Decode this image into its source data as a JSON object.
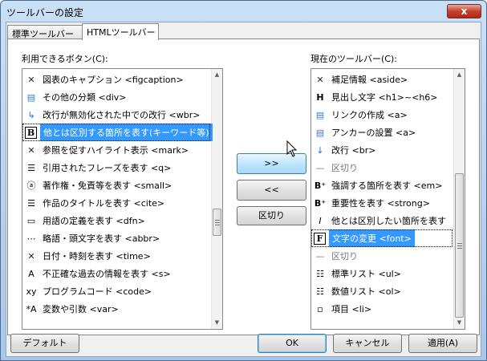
{
  "window": {
    "title": "ツールバーの設定",
    "close_glyph": "x"
  },
  "tabs": [
    {
      "label": "標準ツールバー",
      "active": false
    },
    {
      "label": "HTMLツールバー",
      "active": true
    }
  ],
  "available": {
    "label": "利用できるボタン(C):",
    "items": [
      {
        "icon": "x-icon",
        "glyph": "✕",
        "label": "図表のキャプション <figcaption>"
      },
      {
        "icon": "page-icon",
        "glyph": "▤",
        "label": "その他の分類 <div>"
      },
      {
        "icon": "arrow-icon",
        "glyph": "↳",
        "label": "改行が無効化された中での改行 <wbr>"
      },
      {
        "icon": "bold-b-icon",
        "glyph": "B",
        "label": "他とは区別する箇所を表す(キーワード等)",
        "selected": true
      },
      {
        "icon": "x-icon",
        "glyph": "✕",
        "label": "参照を促すハイライト表示 <mark>"
      },
      {
        "icon": "list-quote-icon",
        "glyph": "☰",
        "label": "引用されたフレーズを表す <q>"
      },
      {
        "icon": "copyright-icon",
        "glyph": "ⓐ",
        "label": "著作権・免責等を表す <small>"
      },
      {
        "icon": "lines-icon",
        "glyph": "☰",
        "label": "作品のタイトルを表す <cite>"
      },
      {
        "icon": "dfn-icon",
        "glyph": "▭",
        "label": "用語の定義を表す <dfn>"
      },
      {
        "icon": "abbr-icon",
        "glyph": "⋯",
        "label": "略語・頭文字を表す <abbr>"
      },
      {
        "icon": "x-icon",
        "glyph": "✕",
        "label": "日付・時刻を表す <time>"
      },
      {
        "icon": "strike-a-icon",
        "glyph": "A",
        "label": "不正確な過去の情報を表す <s>"
      },
      {
        "icon": "xy-icon",
        "glyph": "xy",
        "label": "プログラムコード <code>"
      },
      {
        "icon": "var-a-icon",
        "glyph": "*A",
        "label": "変数や引数 <var>"
      }
    ]
  },
  "current": {
    "label": "現在のツールバー(C):",
    "items": [
      {
        "icon": "x-icon",
        "glyph": "✕",
        "label": "補足情報 <aside>"
      },
      {
        "icon": "h-icon",
        "glyph": "H",
        "label": "見出し文字 <h1>~<h6>"
      },
      {
        "icon": "page-icon",
        "glyph": "▤",
        "label": "リンクの作成 <a>"
      },
      {
        "icon": "anchor-page-icon",
        "glyph": "▤",
        "label": "アンカーの設置 <a>"
      },
      {
        "icon": "down-arrow-icon",
        "glyph": "↓",
        "label": "改行 <br>"
      },
      {
        "icon": "separator-icon",
        "glyph": "—",
        "label": "区切り",
        "dim": true
      },
      {
        "icon": "bold-b-plus-icon",
        "glyph": "B⁺",
        "label": "強調する箇所を表す <em>"
      },
      {
        "icon": "bold-b-plus-icon",
        "glyph": "B⁺",
        "label": "重要性を表す <strong>"
      },
      {
        "icon": "italic-i-icon",
        "glyph": "I",
        "label": "他とは区別したい箇所を表す"
      },
      {
        "icon": "font-f-icon",
        "glyph": "F",
        "label": "文字の変更 <font>",
        "selected": true
      },
      {
        "icon": "separator-icon",
        "glyph": "—",
        "label": "区切り",
        "dim": true
      },
      {
        "icon": "bullet-list-icon",
        "glyph": "☷",
        "label": "標準リスト <ul>"
      },
      {
        "icon": "number-list-icon",
        "glyph": "☷",
        "label": "数値リスト <ol>"
      },
      {
        "icon": "list-item-icon",
        "glyph": "▫",
        "label": "項目 <li>"
      }
    ]
  },
  "middle_buttons": {
    "add": ">>",
    "remove": "<<",
    "separator": "区切り"
  },
  "footer": {
    "default": "デフォルト",
    "ok": "OK",
    "cancel": "キャンセル",
    "apply": "適用(A)"
  }
}
